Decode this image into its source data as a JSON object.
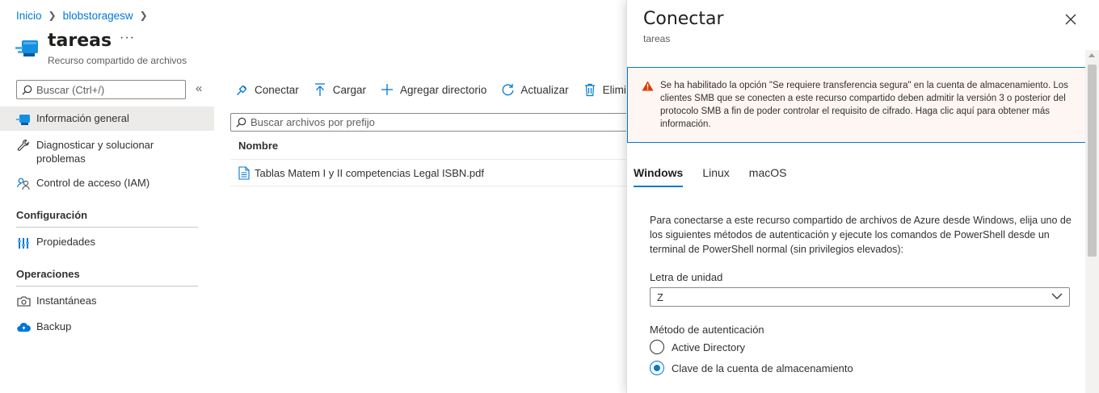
{
  "breadcrumb": {
    "home": "Inicio",
    "account": "blobstoragesw"
  },
  "resource": {
    "title": "tareas",
    "more": "···",
    "subtitle": "Recurso compartido de archivos"
  },
  "left_search": {
    "placeholder": "Buscar (Ctrl+/)"
  },
  "nav": {
    "overview": "Información general",
    "diagnose": "Diagnosticar y solucionar problemas",
    "iam": "Control de acceso (IAM)",
    "section_config": "Configuración",
    "properties": "Propiedades",
    "section_ops": "Operaciones",
    "snapshots": "Instantáneas",
    "backup": "Backup"
  },
  "toolbar": {
    "connect": "Conectar",
    "upload": "Cargar",
    "add_dir": "Agregar directorio",
    "refresh": "Actualizar",
    "delete": "Eliminar"
  },
  "file_search": {
    "placeholder": "Buscar archivos por prefijo"
  },
  "table": {
    "column": "Nombre",
    "rows": [
      {
        "name": "Tablas Matem I y II competencias Legal ISBN.pdf"
      }
    ]
  },
  "panel": {
    "title": "Conectar",
    "subtitle": "tareas",
    "warning": "Se ha habilitado la opción \"Se requiere transferencia segura\" en la cuenta de almacenamiento. Los clientes SMB que se conecten a este recurso compartido deben admitir la versión 3 o posterior del protocolo SMB a fin de poder controlar el requisito de cifrado. Haga clic aquí para obtener más información.",
    "tabs": [
      "Windows",
      "Linux",
      "macOS"
    ],
    "description": "Para conectarse a este recurso compartido de archivos de Azure desde Windows, elija uno de los siguientes métodos de autenticación y ejecute los comandos de PowerShell desde un terminal de PowerShell normal (sin privilegios elevados):",
    "drive_label": "Letra de unidad",
    "drive_value": "Z",
    "auth_label": "Método de autenticación",
    "auth_options": [
      "Active Directory",
      "Clave de la cuenta de almacenamiento"
    ],
    "auth_selected": "Clave de la cuenta de almacenamiento"
  },
  "colors": {
    "accent": "#0078d4",
    "warning_icon": "#d83b01",
    "warning_bg": "#fdf6f3"
  }
}
